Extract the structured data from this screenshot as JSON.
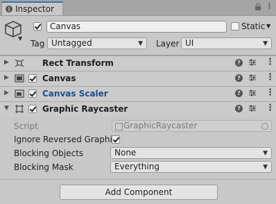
{
  "tab": {
    "title": "Inspector"
  },
  "header": {
    "name": "Canvas",
    "static_label": "Static",
    "tag_label": "Tag",
    "tag_value": "Untagged",
    "layer_label": "Layer",
    "layer_value": "UI"
  },
  "components": [
    {
      "title": "Rect Transform",
      "icon": "rect-transform-icon"
    },
    {
      "title": "Canvas",
      "icon": "canvas-icon"
    },
    {
      "title": "Canvas Scaler",
      "icon": "canvas-scaler-icon"
    },
    {
      "title": "Graphic Raycaster",
      "icon": "graphic-raycaster-icon"
    }
  ],
  "properties": {
    "script_label": "Script",
    "script_value": "GraphicRaycaster",
    "ignore_reversed_label": "Ignore Reversed Graphic",
    "blocking_objects_label": "Blocking Objects",
    "blocking_objects_value": "None",
    "blocking_mask_label": "Blocking Mask",
    "blocking_mask_value": "Everything"
  },
  "add_component_label": "Add Component",
  "colors": {
    "accent": "#3a72b0",
    "link_blue": "#1d4f8a",
    "panel_bg": "#c8c8c8"
  }
}
